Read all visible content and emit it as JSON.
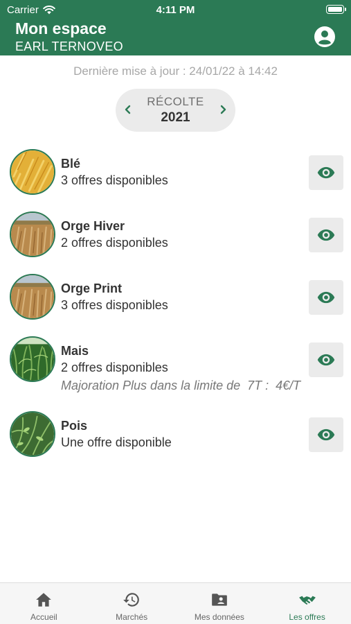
{
  "status_bar": {
    "carrier": "Carrier",
    "time": "4:11 PM"
  },
  "header": {
    "title": "Mon espace",
    "subtitle": "EARL TERNOVEO",
    "account_icon": "account-circle-icon"
  },
  "last_update": "Dernière mise à jour : 24/01/22 à 14:42",
  "season": {
    "label": "RÉCOLTE",
    "year": "2021"
  },
  "crops": [
    {
      "name": "Blé",
      "offers": "3 offres disponibles",
      "note": "",
      "image": "wheat"
    },
    {
      "name": "Orge Hiver",
      "offers": "2 offres disponibles",
      "note": "",
      "image": "barley"
    },
    {
      "name": "Orge Print",
      "offers": "3 offres disponibles",
      "note": "",
      "image": "barley"
    },
    {
      "name": "Mais",
      "offers": "2 offres disponibles",
      "note": "Majoration Plus dans la limite de  7T :  4€/T",
      "image": "corn"
    },
    {
      "name": "Pois",
      "offers": "Une offre disponible",
      "note": "",
      "image": "peas"
    }
  ],
  "tabs": [
    {
      "label": "Accueil",
      "icon": "home-icon",
      "active": false
    },
    {
      "label": "Marchés",
      "icon": "history-icon",
      "active": false
    },
    {
      "label": "Mes données",
      "icon": "folder-account-icon",
      "active": false
    },
    {
      "label": "Les offres",
      "icon": "handshake-icon",
      "active": true
    }
  ],
  "colors": {
    "primary": "#2b7a55",
    "muted": "#a7a7a7",
    "button_bg": "#ebebeb"
  }
}
